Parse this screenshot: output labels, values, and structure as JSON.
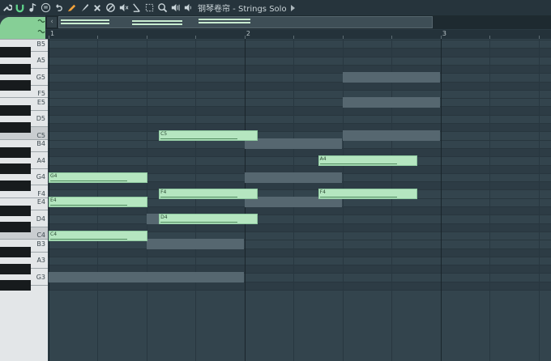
{
  "window": {
    "title": "钢琴卷帘 - Strings Solo"
  },
  "toolbar": {
    "icons": [
      "wrench-icon",
      "magnet-icon",
      "note-icon",
      "menu-icon",
      "undo-icon",
      "pencil-icon",
      "paint-brush-icon",
      "delete-icon",
      "mute-icon",
      "mute-all-icon",
      "slice-icon",
      "select-icon",
      "zoom-icon",
      "speaker-icon",
      "playback-icon"
    ]
  },
  "overview": {
    "scroll_left_label": "‹"
  },
  "ruler": {
    "labels": [
      "1",
      "2",
      "3"
    ]
  },
  "keyboard": {
    "labels": [
      "B5",
      "A5",
      "G5",
      "F5",
      "E5",
      "D5",
      "C5",
      "B4",
      "A4",
      "G4",
      "F4",
      "E4",
      "D4",
      "C4",
      "B3",
      "A3",
      "G3"
    ]
  },
  "notes": [
    {
      "pitch": "C5",
      "label": "C5",
      "start_step": 9,
      "length_steps": 8
    },
    {
      "pitch": "A4",
      "label": "A4",
      "start_step": 22,
      "length_steps": 8
    },
    {
      "pitch": "G4",
      "label": "G4",
      "start_step": 0,
      "length_steps": 8
    },
    {
      "pitch": "F4",
      "label": "F4",
      "start_step": 9,
      "length_steps": 8
    },
    {
      "pitch": "F4",
      "label": "F4",
      "start_step": 22,
      "length_steps": 8
    },
    {
      "pitch": "E4",
      "label": "E4",
      "start_step": 0,
      "length_steps": 8
    },
    {
      "pitch": "D4",
      "label": "D4",
      "start_step": 9,
      "length_steps": 8
    },
    {
      "pitch": "C4",
      "label": "C4",
      "start_step": 0,
      "length_steps": 8
    }
  ],
  "ghost_notes": [
    {
      "pitch": "G5",
      "start_step": 24,
      "length_steps": 8
    },
    {
      "pitch": "E5",
      "start_step": 24,
      "length_steps": 8
    },
    {
      "pitch": "C5",
      "start_step": 24,
      "length_steps": 8
    },
    {
      "pitch": "B4",
      "start_step": 16,
      "length_steps": 8
    },
    {
      "pitch": "G4",
      "start_step": 16,
      "length_steps": 8
    },
    {
      "pitch": "E4",
      "start_step": 16,
      "length_steps": 8
    },
    {
      "pitch": "D4",
      "start_step": 8,
      "length_steps": 8
    },
    {
      "pitch": "B3",
      "start_step": 8,
      "length_steps": 8
    },
    {
      "pitch": "G3",
      "start_step": 0,
      "length_steps": 16
    }
  ],
  "colors": {
    "note_fill": "#b5e6c0",
    "note_border": "#8fc9a0",
    "ghost_note": "#566770",
    "grid_bg": "#33444d",
    "accent_green": "#7dc98c"
  }
}
